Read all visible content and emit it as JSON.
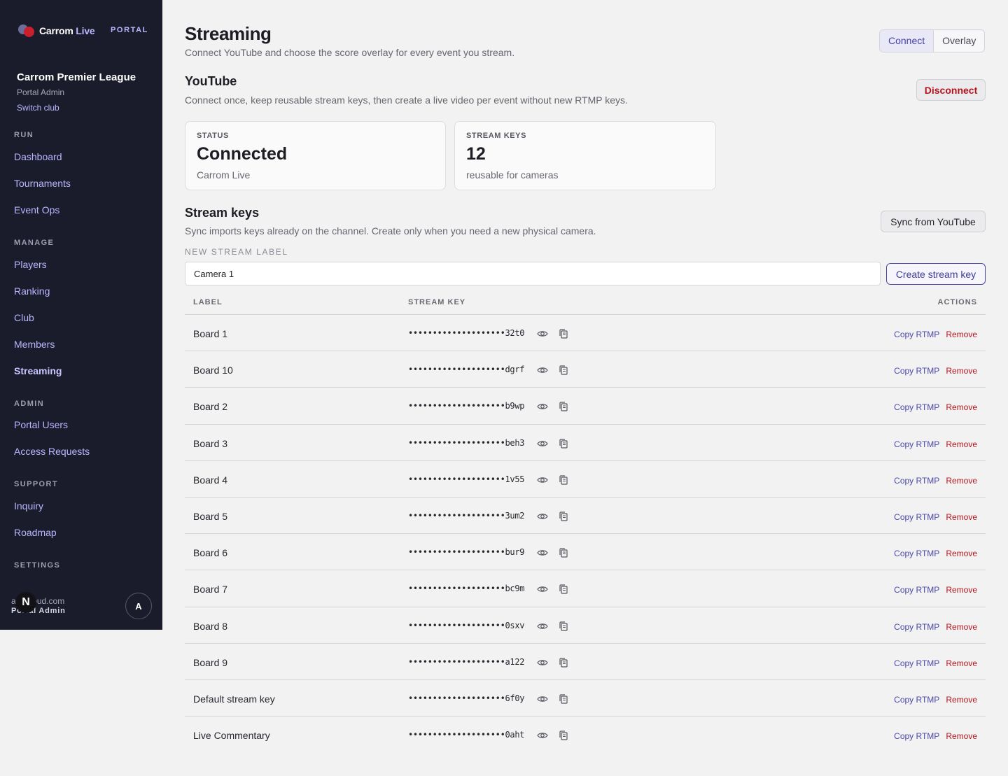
{
  "brand": {
    "name_part1": "Carrom",
    "name_part2": "Live",
    "portal_label": "PORTAL"
  },
  "club": {
    "name": "Carrom Premier League",
    "role": "Portal Admin",
    "switch_label": "Switch club"
  },
  "sidebar": {
    "sections": [
      {
        "title": "RUN",
        "items": [
          "Dashboard",
          "Tournaments",
          "Event Ops"
        ]
      },
      {
        "title": "MANAGE",
        "items": [
          "Players",
          "Ranking",
          "Club",
          "Members",
          "Streaming"
        ]
      },
      {
        "title": "ADMIN",
        "items": [
          "Portal Users",
          "Access Requests"
        ]
      },
      {
        "title": "SUPPORT",
        "items": [
          "Inquiry",
          "Roadmap"
        ]
      },
      {
        "title": "SETTINGS",
        "items": []
      }
    ],
    "active_item": "Streaming"
  },
  "user": {
    "email": "a@icloud.com",
    "role": "Portal Admin",
    "badge": "N",
    "avatar": "A"
  },
  "page": {
    "title": "Streaming",
    "subtitle": "Connect YouTube and choose the score overlay for every event you stream.",
    "tabs": [
      {
        "label": "Connect",
        "active": true
      },
      {
        "label": "Overlay",
        "active": false
      }
    ]
  },
  "youtube": {
    "title": "YouTube",
    "subtitle": "Connect once, keep reusable stream keys, then create a live video per event without new RTMP keys.",
    "disconnect_label": "Disconnect",
    "status_card": {
      "label": "STATUS",
      "value": "Connected",
      "note": "Carrom Live"
    },
    "keys_card": {
      "label": "STREAM KEYS",
      "value": "12",
      "note": "reusable for cameras"
    }
  },
  "stream_keys": {
    "title": "Stream keys",
    "subtitle": "Sync imports keys already on the channel. Create only when you need a new physical camera.",
    "sync_label": "Sync from YouTube",
    "field_label": "NEW STREAM LABEL",
    "input_value": "Camera 1",
    "create_label": "Create stream key",
    "columns": [
      "LABEL",
      "STREAM KEY",
      "ACTIONS"
    ],
    "copy_label": "Copy RTMP",
    "remove_label": "Remove",
    "rows": [
      {
        "label": "Board 1",
        "key": "••••••••••••••••••••32t0"
      },
      {
        "label": "Board 10",
        "key": "••••••••••••••••••••dgrf"
      },
      {
        "label": "Board 2",
        "key": "••••••••••••••••••••b9wp"
      },
      {
        "label": "Board 3",
        "key": "••••••••••••••••••••beh3"
      },
      {
        "label": "Board 4",
        "key": "••••••••••••••••••••1v55"
      },
      {
        "label": "Board 5",
        "key": "••••••••••••••••••••3um2"
      },
      {
        "label": "Board 6",
        "key": "••••••••••••••••••••bur9"
      },
      {
        "label": "Board 7",
        "key": "••••••••••••••••••••bc9m"
      },
      {
        "label": "Board 8",
        "key": "••••••••••••••••••••0sxv"
      },
      {
        "label": "Board 9",
        "key": "••••••••••••••••••••a122"
      },
      {
        "label": "Default stream key",
        "key": "••••••••••••••••••••6f0y"
      },
      {
        "label": "Live Commentary",
        "key": "••••••••••••••••••••0aht"
      }
    ]
  },
  "icons": {
    "reveal": "eye-icon",
    "copy": "copy-icon"
  },
  "colors": {
    "sidebar_bg": "#1b1c2b",
    "accent": "#4b48a8",
    "danger": "#b3141c",
    "page_bg": "#f2f2f2"
  }
}
